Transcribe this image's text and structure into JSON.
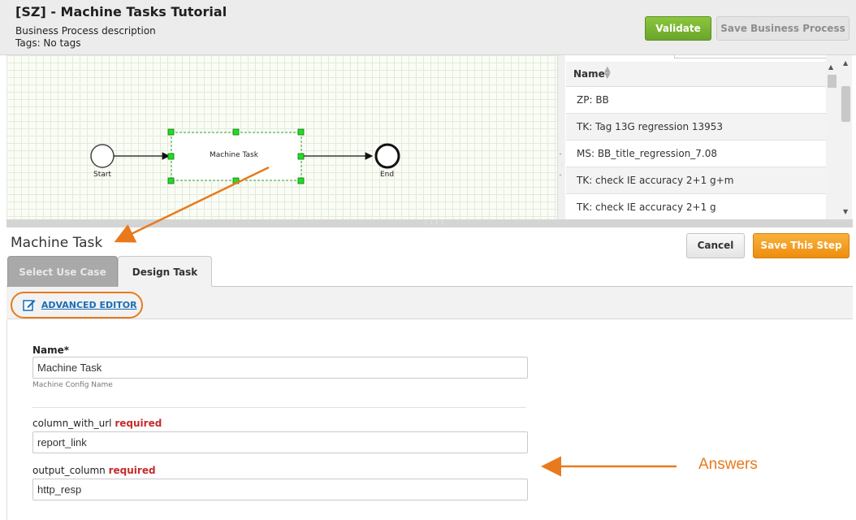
{
  "header": {
    "title": "[SZ] - Machine Tasks Tutorial",
    "description": "Business Process description",
    "tags": "Tags: No tags",
    "validate_label": "Validate",
    "save_bp_label": "Save Business Process"
  },
  "canvas": {
    "start_label": "Start",
    "task_label": "Machine Task",
    "end_label": "End"
  },
  "list": {
    "column_header": "Name",
    "rows": [
      "ZP: BB",
      "TK: Tag 13G regression 13953",
      "MS: BB_title_regression_7.08",
      "TK: check IE accuracy 2+1 g+m",
      "TK: check IE accuracy 2+1 g"
    ]
  },
  "step": {
    "title": "Machine Task",
    "cancel_label": "Cancel",
    "save_label": "Save This Step",
    "tabs": [
      "Select Use Case",
      "Design Task"
    ],
    "advanced_editor_label": "ADVANCED EDITOR"
  },
  "form": {
    "name_label": "Name*",
    "name_value": "Machine Task",
    "name_hint": "Machine Config Name",
    "field1_label": "column_with_url",
    "field1_required": "required",
    "field1_value": "report_link",
    "field2_label": "output_column",
    "field2_required": "required",
    "field2_value": "http_resp"
  },
  "annotation": {
    "answers_text": "Answers"
  },
  "colors": {
    "validate_green": "#7ab535",
    "save_orange": "#f29a1f",
    "annotation_orange": "#e87a1d",
    "link_blue": "#1a6db5",
    "required_red": "#c62b2b"
  }
}
